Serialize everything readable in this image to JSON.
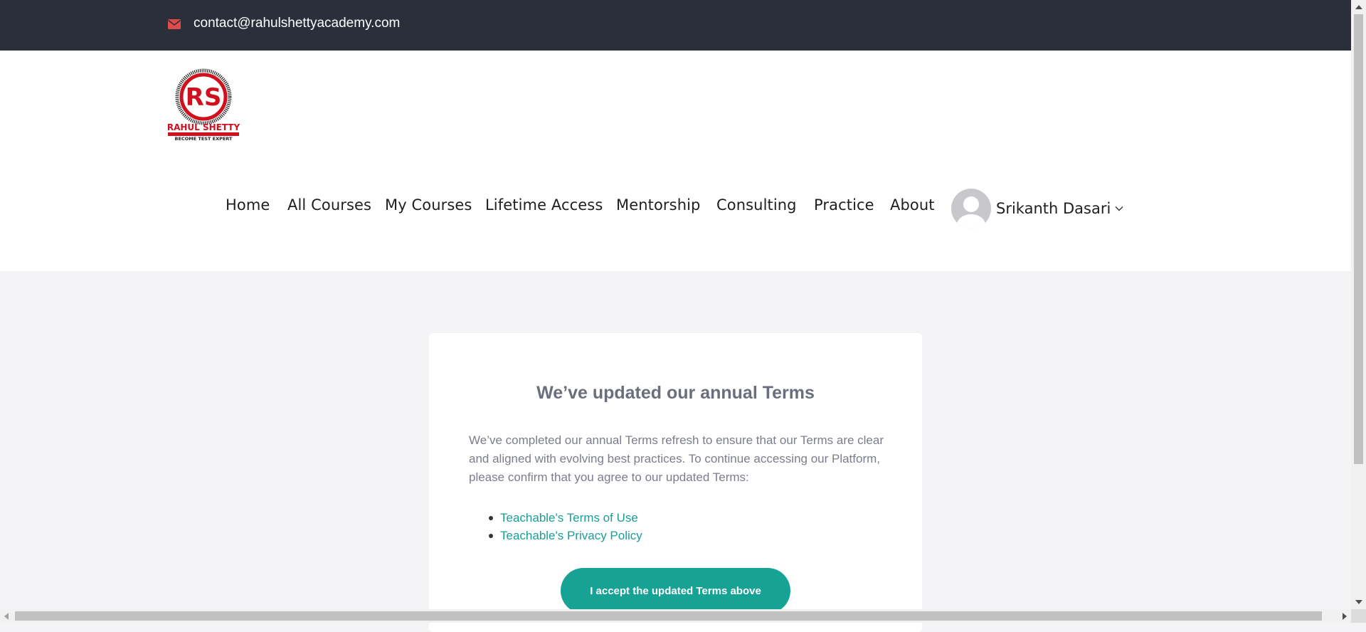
{
  "topbar": {
    "email": "contact@rahulshettyacademy.com",
    "mail_icon": "envelope-icon",
    "background": "#2a2f3a",
    "icon_color": "#e04a4a"
  },
  "logo": {
    "initials": "RS",
    "name": "RAHUL SHETTY",
    "tagline": "BECOME TEST EXPERT",
    "brand_color": "#d1101e"
  },
  "nav": {
    "items": [
      {
        "label": "Home"
      },
      {
        "label": "All Courses"
      },
      {
        "label": "My Courses"
      },
      {
        "label": "Lifetime Access"
      },
      {
        "label": "Mentorship"
      },
      {
        "label": "Consulting"
      },
      {
        "label": "Practice"
      },
      {
        "label": "About"
      }
    ],
    "user": {
      "name": "Srikanth Dasari",
      "avatar_icon": "user-avatar-icon",
      "dropdown_icon": "chevron-down-icon"
    }
  },
  "terms_card": {
    "title": "We’ve updated our annual Terms",
    "body": "We’ve completed our annual Terms refresh to ensure that our Terms are clear and aligned with evolving best practices. To continue accessing our Platform, please confirm that you agree to our updated Terms:",
    "links": [
      {
        "label": "Teachable's Terms of Use"
      },
      {
        "label": "Teachable's Privacy Policy"
      }
    ],
    "accept_label": "I accept the updated Terms above",
    "accent_color": "#16a295"
  }
}
